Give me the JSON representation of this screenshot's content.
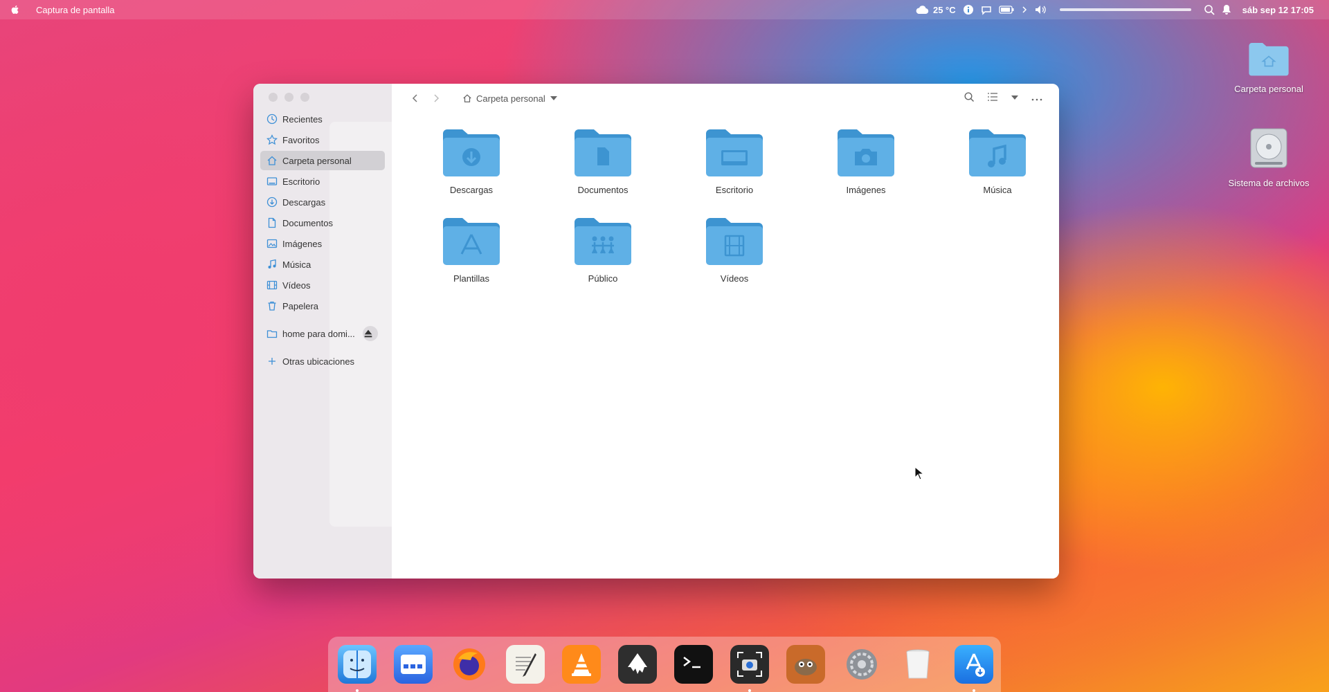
{
  "menubar": {
    "app_title": "Captura de pantalla",
    "temperature": "25 °C",
    "datetime": "sáb sep 12 17:05"
  },
  "desktop": {
    "icons": [
      {
        "label": "Carpeta personal"
      },
      {
        "label": "Sistema de archivos"
      }
    ]
  },
  "window": {
    "breadcrumb": "Carpeta personal",
    "sidebar": {
      "items": [
        {
          "label": "Recientes"
        },
        {
          "label": "Favoritos"
        },
        {
          "label": "Carpeta personal"
        },
        {
          "label": "Escritorio"
        },
        {
          "label": "Descargas"
        },
        {
          "label": "Documentos"
        },
        {
          "label": "Imágenes"
        },
        {
          "label": "Música"
        },
        {
          "label": "Vídeos"
        },
        {
          "label": "Papelera"
        }
      ],
      "mount": "home para domi...",
      "other": "Otras ubicaciones"
    },
    "folders": [
      {
        "label": "Descargas",
        "icon": "download-icon"
      },
      {
        "label": "Documentos",
        "icon": "document-icon"
      },
      {
        "label": "Escritorio",
        "icon": "desktop-icon"
      },
      {
        "label": "Imágenes",
        "icon": "camera-icon"
      },
      {
        "label": "Música",
        "icon": "music-note-icon"
      },
      {
        "label": "Plantillas",
        "icon": "template-icon"
      },
      {
        "label": "Público",
        "icon": "people-icon"
      },
      {
        "label": "Vídeos",
        "icon": "film-icon"
      }
    ]
  },
  "dock": {
    "apps": [
      "finder-icon",
      "app-launcher-icon",
      "firefox-icon",
      "text-editor-icon",
      "vlc-icon",
      "inkscape-icon",
      "terminal-icon",
      "screenshot-icon",
      "gimp-icon",
      "settings-icon",
      "trash-icon",
      "app-store-icon"
    ]
  },
  "colors": {
    "folder": "#5fb0e6",
    "folder_dark": "#3d94d1",
    "sidebar_bg": "#ece8ec",
    "active_item": "#d2d0d4"
  }
}
